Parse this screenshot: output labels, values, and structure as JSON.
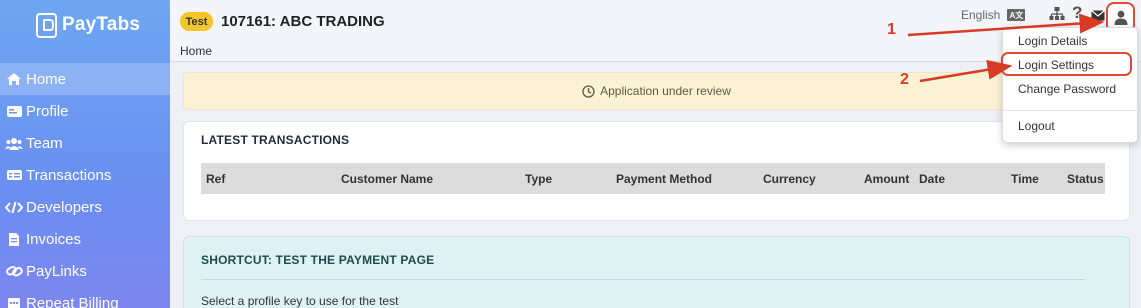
{
  "brand": {
    "name": "PayTabs"
  },
  "header": {
    "badge": "Test",
    "title": "107161: ABC TRADING",
    "breadcrumb": "Home",
    "language": "English"
  },
  "sidebar": {
    "items": [
      {
        "label": "Home",
        "icon": "home-icon",
        "active": true
      },
      {
        "label": "Profile",
        "icon": "profile-card-icon"
      },
      {
        "label": "Team",
        "icon": "team-icon"
      },
      {
        "label": "Transactions",
        "icon": "transactions-icon"
      },
      {
        "label": "Developers",
        "icon": "code-icon"
      },
      {
        "label": "Invoices",
        "icon": "invoice-icon"
      },
      {
        "label": "PayLinks",
        "icon": "link-icon"
      },
      {
        "label": "Repeat Billing",
        "icon": "calendar-icon"
      }
    ]
  },
  "banner": {
    "text": "Application under review",
    "icon": "clock-icon"
  },
  "transactions": {
    "title": "LATEST TRANSACTIONS",
    "columns": [
      "Ref",
      "Customer Name",
      "Type",
      "Payment Method",
      "Currency",
      "Amount",
      "Date",
      "Time",
      "Status"
    ]
  },
  "shortcut": {
    "title": "SHORTCUT: TEST THE PAYMENT PAGE",
    "description": "Select a profile key to use for the test"
  },
  "user_menu": {
    "items": [
      "Login Details",
      "Login Settings",
      "Change Password",
      "Logout"
    ]
  },
  "annotations": {
    "step1": "1",
    "step2": "2"
  },
  "colors": {
    "sidebar": "#6a8ff0",
    "annotation": "#d83a26",
    "badge": "#f5c62c",
    "banner": "#fbf1d4",
    "shortcut": "#dff2f3"
  }
}
